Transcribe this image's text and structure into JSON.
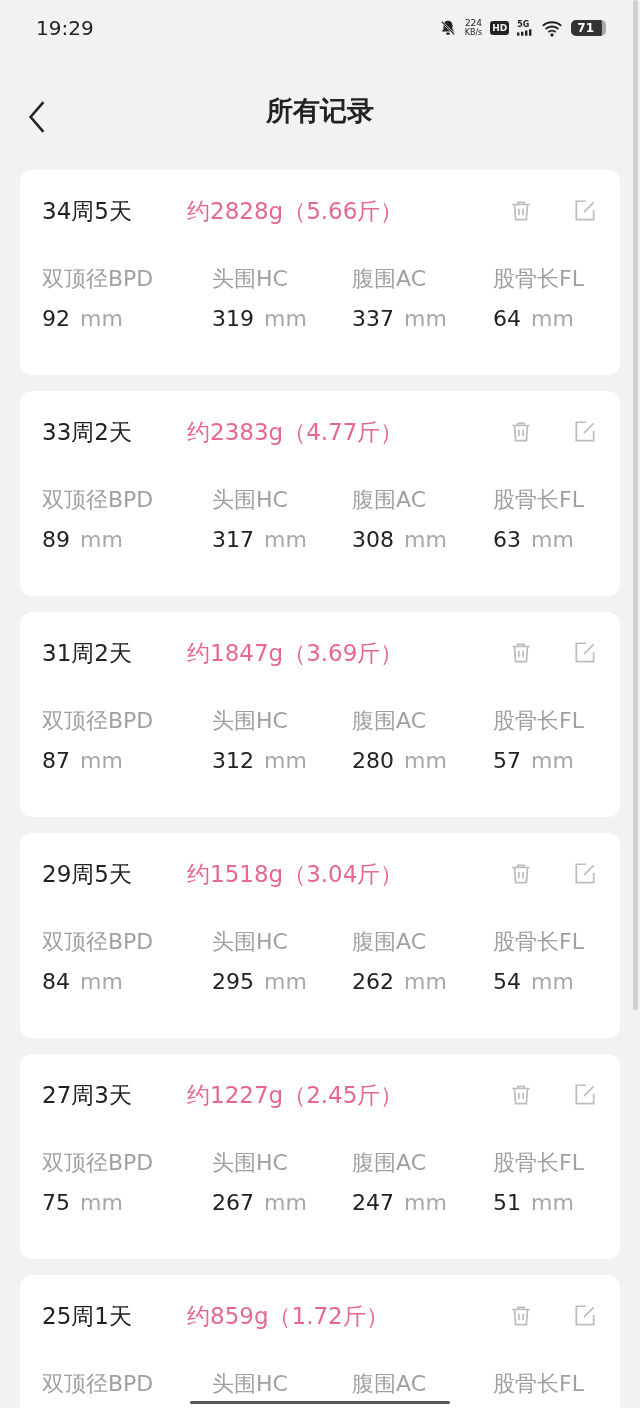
{
  "status_bar": {
    "time": "19:29",
    "net_speed": "224",
    "net_unit": "KB/s",
    "hd": "HD",
    "network": "5G",
    "battery": "71"
  },
  "header": {
    "title": "所有记录"
  },
  "records": [
    {
      "week": "34周5天",
      "weight": "约2828g（5.66斤）",
      "metrics": [
        {
          "label": "双顶径BPD",
          "value": "92",
          "unit": "mm"
        },
        {
          "label": "头围HC",
          "value": "319",
          "unit": "mm"
        },
        {
          "label": "腹围AC",
          "value": "337",
          "unit": "mm"
        },
        {
          "label": "股骨长FL",
          "value": "64",
          "unit": "mm"
        }
      ]
    },
    {
      "week": "33周2天",
      "weight": "约2383g（4.77斤）",
      "metrics": [
        {
          "label": "双顶径BPD",
          "value": "89",
          "unit": "mm"
        },
        {
          "label": "头围HC",
          "value": "317",
          "unit": "mm"
        },
        {
          "label": "腹围AC",
          "value": "308",
          "unit": "mm"
        },
        {
          "label": "股骨长FL",
          "value": "63",
          "unit": "mm"
        }
      ]
    },
    {
      "week": "31周2天",
      "weight": "约1847g（3.69斤）",
      "metrics": [
        {
          "label": "双顶径BPD",
          "value": "87",
          "unit": "mm"
        },
        {
          "label": "头围HC",
          "value": "312",
          "unit": "mm"
        },
        {
          "label": "腹围AC",
          "value": "280",
          "unit": "mm"
        },
        {
          "label": "股骨长FL",
          "value": "57",
          "unit": "mm"
        }
      ]
    },
    {
      "week": "29周5天",
      "weight": "约1518g（3.04斤）",
      "metrics": [
        {
          "label": "双顶径BPD",
          "value": "84",
          "unit": "mm"
        },
        {
          "label": "头围HC",
          "value": "295",
          "unit": "mm"
        },
        {
          "label": "腹围AC",
          "value": "262",
          "unit": "mm"
        },
        {
          "label": "股骨长FL",
          "value": "54",
          "unit": "mm"
        }
      ]
    },
    {
      "week": "27周3天",
      "weight": "约1227g（2.45斤）",
      "metrics": [
        {
          "label": "双顶径BPD",
          "value": "75",
          "unit": "mm"
        },
        {
          "label": "头围HC",
          "value": "267",
          "unit": "mm"
        },
        {
          "label": "腹围AC",
          "value": "247",
          "unit": "mm"
        },
        {
          "label": "股骨长FL",
          "value": "51",
          "unit": "mm"
        }
      ]
    },
    {
      "week": "25周1天",
      "weight": "约859g（1.72斤）",
      "metrics": [
        {
          "label": "双顶径BPD"
        },
        {
          "label": "头围HC"
        },
        {
          "label": "腹围AC"
        },
        {
          "label": "股骨长FL"
        }
      ]
    }
  ]
}
